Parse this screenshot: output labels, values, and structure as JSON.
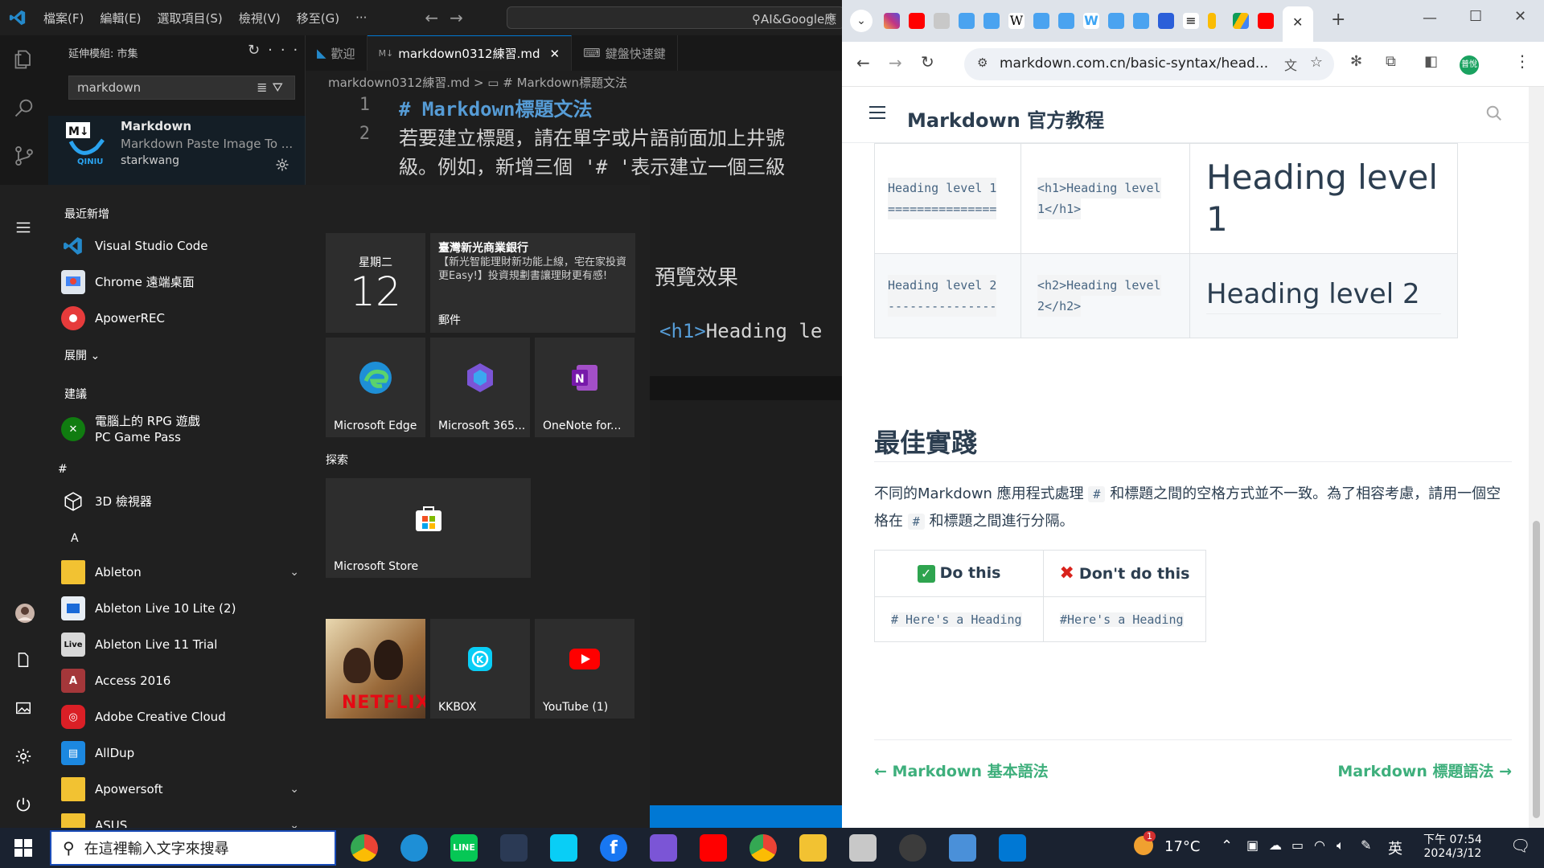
{
  "vscode": {
    "menus": [
      "檔案(F)",
      "編輯(E)",
      "選取項目(S)",
      "檢視(V)",
      "移至(G)",
      "···"
    ],
    "search_text": "AI&Google應",
    "sidebar": {
      "title": "延伸模組: 市集",
      "search_value": "markdown",
      "extension": {
        "name": "Markdown",
        "description": "Markdown Paste Image To ...",
        "author": "starkwang",
        "logo_text": "M↓",
        "logo_sub": "QINIU"
      }
    },
    "tabs": [
      {
        "label": "歡迎",
        "active": false
      },
      {
        "label": "markdown0312練習.md",
        "active": true
      },
      {
        "label": "鍵盤快速鍵",
        "active": false
      }
    ],
    "breadcrumb": "markdown0312練習.md > ▭ # Markdown標題文法",
    "editor": {
      "lines": [
        {
          "num": "1",
          "text": "# Markdown標題文法"
        },
        {
          "num": "2",
          "text": "若要建立標題，請在單字或片語前面加上井號"
        },
        {
          "num": "",
          "text": "級。例如，新增三個 '# '表示建立一個三級"
        }
      ]
    },
    "preview": {
      "title": "預覽效果",
      "code_tag": "<h1>",
      "code_text": "Heading le"
    }
  },
  "start_menu": {
    "recent_header": "最近新增",
    "recent": [
      {
        "label": "Visual Studio Code",
        "icon": "vscode-icon"
      },
      {
        "label": "Chrome 遠端桌面",
        "icon": "chrome-remote-icon"
      },
      {
        "label": "ApowerREC",
        "icon": "apowerrec-icon"
      }
    ],
    "expand": "展開 ⌄",
    "suggest_header": "建議",
    "suggest": {
      "line1": "電腦上的 RPG 遊戲",
      "line2": "PC Game Pass"
    },
    "hash_header": "#",
    "app_3d": "3D 檢視器",
    "a_header": "A",
    "apps": [
      {
        "label": "Ableton",
        "icon": "folder-icon",
        "expandable": true
      },
      {
        "label": "Ableton Live 10 Lite (2)",
        "icon": "ableton-icon",
        "expandable": false
      },
      {
        "label": "Ableton Live 11 Trial",
        "icon": "ableton-live-icon",
        "expandable": false
      },
      {
        "label": "Access 2016",
        "icon": "access-icon",
        "expandable": false
      },
      {
        "label": "Adobe Creative Cloud",
        "icon": "adobe-cc-icon",
        "expandable": false
      },
      {
        "label": "AllDup",
        "icon": "alldup-icon",
        "expandable": false
      },
      {
        "label": "Apowersoft",
        "icon": "folder-icon",
        "expandable": true
      },
      {
        "label": "ASUS",
        "icon": "folder-icon",
        "expandable": true
      }
    ],
    "calendar": {
      "weekday": "星期二",
      "day": "12"
    },
    "mail_tile": {
      "sender": "臺灣新光商業銀行",
      "body": "【新光智能理財新功能上線，宅在家投資更Easy!】投資規劃書讓理財更有感!",
      "label": "郵件"
    },
    "tiles_row": [
      "Microsoft Edge",
      "Microsoft 365...",
      "OneNote for..."
    ],
    "explore_header": "探索",
    "store_tile": "Microsoft Store",
    "bottom_tiles": [
      "NETFLIX",
      "KKBOX",
      "YouTube (1)"
    ]
  },
  "chrome": {
    "url": "markdown.com.cn/basic-syntax/head...",
    "profile": "普悅",
    "site_title": "Markdown 官方教程",
    "table_rows": [
      {
        "md1": "Heading level 1",
        "md2": "===============",
        "html1": "<h1>Heading level",
        "html2": "1</h1>",
        "render1": "Heading level",
        "render2": "1"
      },
      {
        "md1": "Heading level 2",
        "md2": "---------------",
        "html1": "<h2>Heading level",
        "html2": "2</h2>",
        "render1": "Heading level 2",
        "render2": ""
      }
    ],
    "best_practice_title": "最佳實踐",
    "best_practice_p1": "不同的Markdown 應用程式處理",
    "best_practice_c1": "#",
    "best_practice_p2": "和標題之間的空格方式並不一致。為了相容考慮，請用一個空格在",
    "best_practice_c2": "#",
    "best_practice_p3": "和標題之間進行分隔。",
    "do_header": "Do this",
    "dont_header": "Don't do this",
    "do_example": "# Here's a Heading",
    "dont_example": "#Here's a Heading",
    "prev_link": "← Markdown 基本語法",
    "next_link": "Markdown 標題語法 →"
  },
  "taskbar": {
    "search_placeholder": "在這裡輸入文字來搜尋",
    "weather": "17°C",
    "ime": "英",
    "time": "下午 07:54",
    "date": "2024/3/12",
    "weather_badge": "1"
  },
  "colors": {
    "vscode_accent": "#0078d4",
    "site_green": "#3eaf7c",
    "heading_blue": "#569cd6"
  }
}
